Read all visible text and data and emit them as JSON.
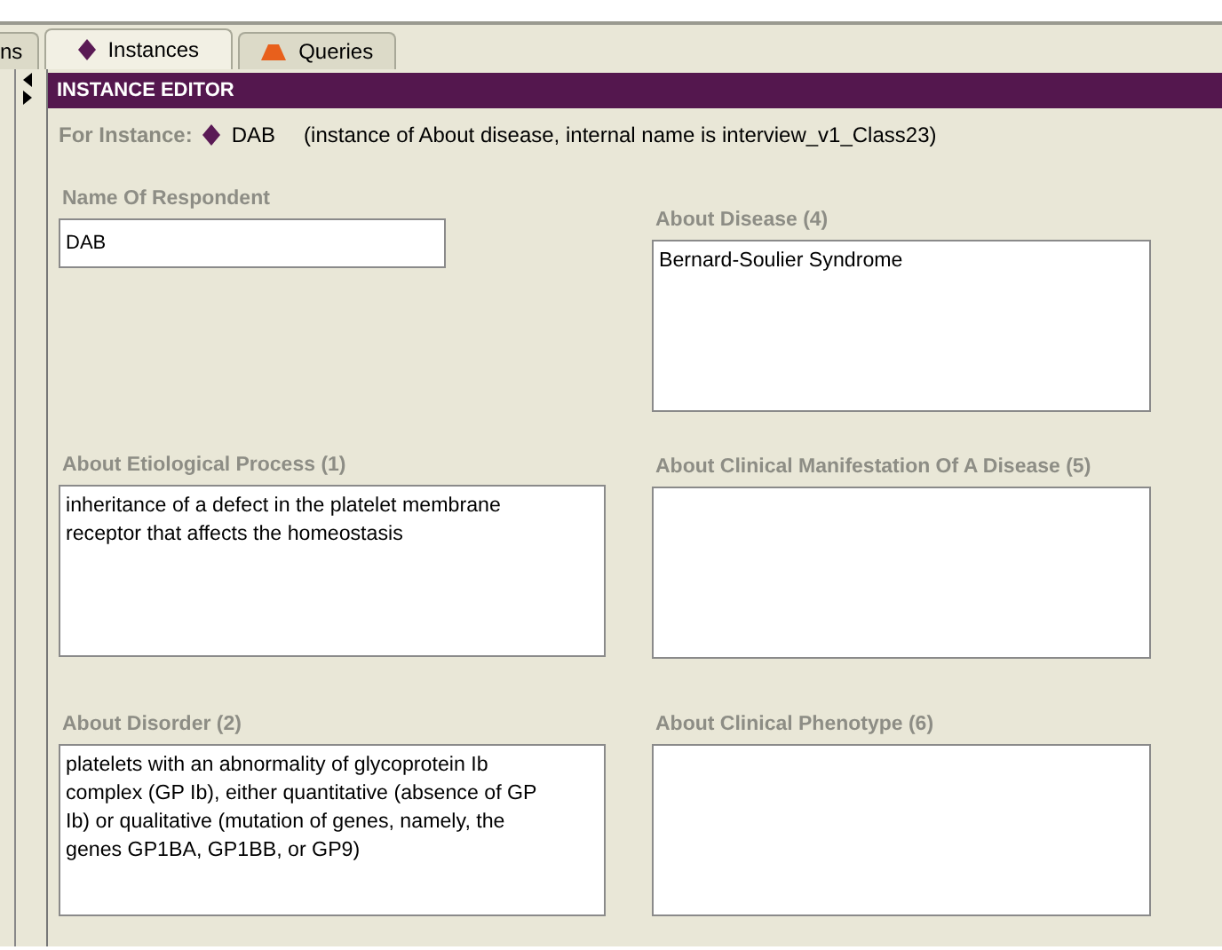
{
  "tabs": [
    {
      "label": "ns",
      "kind": "plain",
      "selected": false
    },
    {
      "label": "Instances",
      "kind": "instances",
      "selected": true
    },
    {
      "label": "Queries",
      "kind": "queries",
      "selected": false
    }
  ],
  "editor": {
    "title": "INSTANCE EDITOR",
    "for_label": "For Instance:",
    "instance_name": "DAB",
    "instance_info": "(instance of About disease, internal name is interview_v1_Class23)",
    "left_fields": [
      {
        "label": "Name Of Respondent",
        "kind": "line",
        "value": "DAB"
      },
      {
        "label": "About Etiological Process (1)",
        "kind": "area",
        "value": "inheritance of a defect in the platelet membrane receptor that affects the homeostasis"
      },
      {
        "label": "About Disorder (2)",
        "kind": "area",
        "value": "platelets with an abnormality of glycoprotein Ib complex (GP Ib), either quantitative (absence of GP Ib) or qualitative (mutation of genes, namely, the genes GP1BA, GP1BB, or GP9)"
      }
    ],
    "right_fields": [
      {
        "label": "About Disease (4)",
        "kind": "area",
        "value": "Bernard-Soulier Syndrome"
      },
      {
        "label": "About Clinical Manifestation Of A Disease (5)",
        "kind": "area"
      },
      {
        "label": "About Clinical Phenotype (6)",
        "kind": "area"
      }
    ]
  }
}
